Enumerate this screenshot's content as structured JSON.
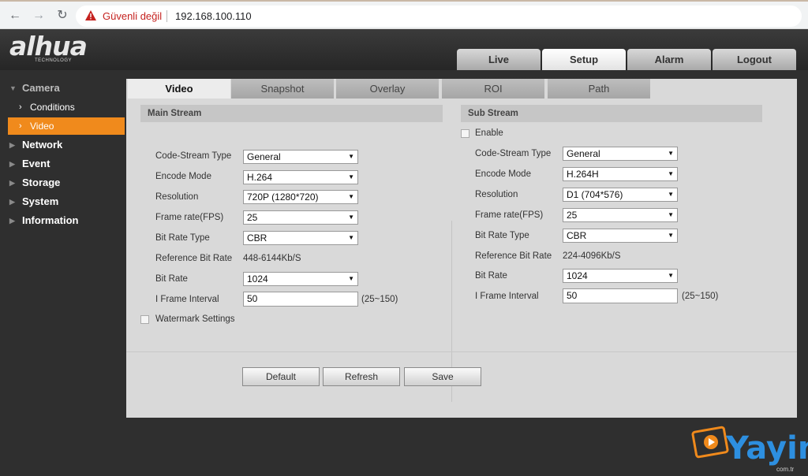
{
  "browser": {
    "back": "←",
    "forward": "→",
    "reload": "↻",
    "security_text": "Güvenli değil",
    "url": "192.168.100.110"
  },
  "header": {
    "logo": "alhua",
    "logo_sub": "TECHNOLOGY",
    "tabs": [
      "Live",
      "Setup",
      "Alarm",
      "Logout"
    ],
    "active_tab": "Setup"
  },
  "sidebar": {
    "camera": "Camera",
    "conditions": "Conditions",
    "video": "Video",
    "network": "Network",
    "event": "Event",
    "storage": "Storage",
    "system": "System",
    "information": "Information"
  },
  "content_tabs": [
    "Video",
    "Snapshot",
    "Overlay",
    "ROI",
    "Path"
  ],
  "main_stream": {
    "title": "Main Stream",
    "labels": {
      "code_stream_type": "Code-Stream Type",
      "encode_mode": "Encode Mode",
      "resolution": "Resolution",
      "frame_rate": "Frame rate(FPS)",
      "bit_rate_type": "Bit Rate Type",
      "reference_bit_rate": "Reference Bit Rate",
      "bit_rate": "Bit Rate",
      "i_frame_interval": "I Frame Interval"
    },
    "values": {
      "code_stream_type": "General",
      "encode_mode": "H.264",
      "resolution": "720P (1280*720)",
      "frame_rate": "25",
      "bit_rate_type": "CBR",
      "reference_bit_rate": "448-6144Kb/S",
      "bit_rate": "1024",
      "i_frame_interval": "50",
      "i_frame_range": "(25~150)"
    },
    "watermark_label": "Watermark Settings"
  },
  "sub_stream": {
    "title": "Sub Stream",
    "enable_label": "Enable",
    "labels": {
      "code_stream_type": "Code-Stream Type",
      "encode_mode": "Encode Mode",
      "resolution": "Resolution",
      "frame_rate": "Frame rate(FPS)",
      "bit_rate_type": "Bit Rate Type",
      "reference_bit_rate": "Reference Bit Rate",
      "bit_rate": "Bit Rate",
      "i_frame_interval": "I Frame Interval"
    },
    "values": {
      "code_stream_type": "General",
      "encode_mode": "H.264H",
      "resolution": "D1 (704*576)",
      "frame_rate": "25",
      "bit_rate_type": "CBR",
      "reference_bit_rate": "224-4096Kb/S",
      "bit_rate": "1024",
      "i_frame_interval": "50",
      "i_frame_range": "(25~150)"
    }
  },
  "buttons": {
    "default": "Default",
    "refresh": "Refresh",
    "save": "Save"
  },
  "watermark": {
    "text": "Yayin",
    "sub": "com.tr"
  },
  "colors": {
    "accent_orange": "#f08a1c",
    "warning_red": "#c5221f",
    "watermark_blue": "#2d8fe0"
  }
}
